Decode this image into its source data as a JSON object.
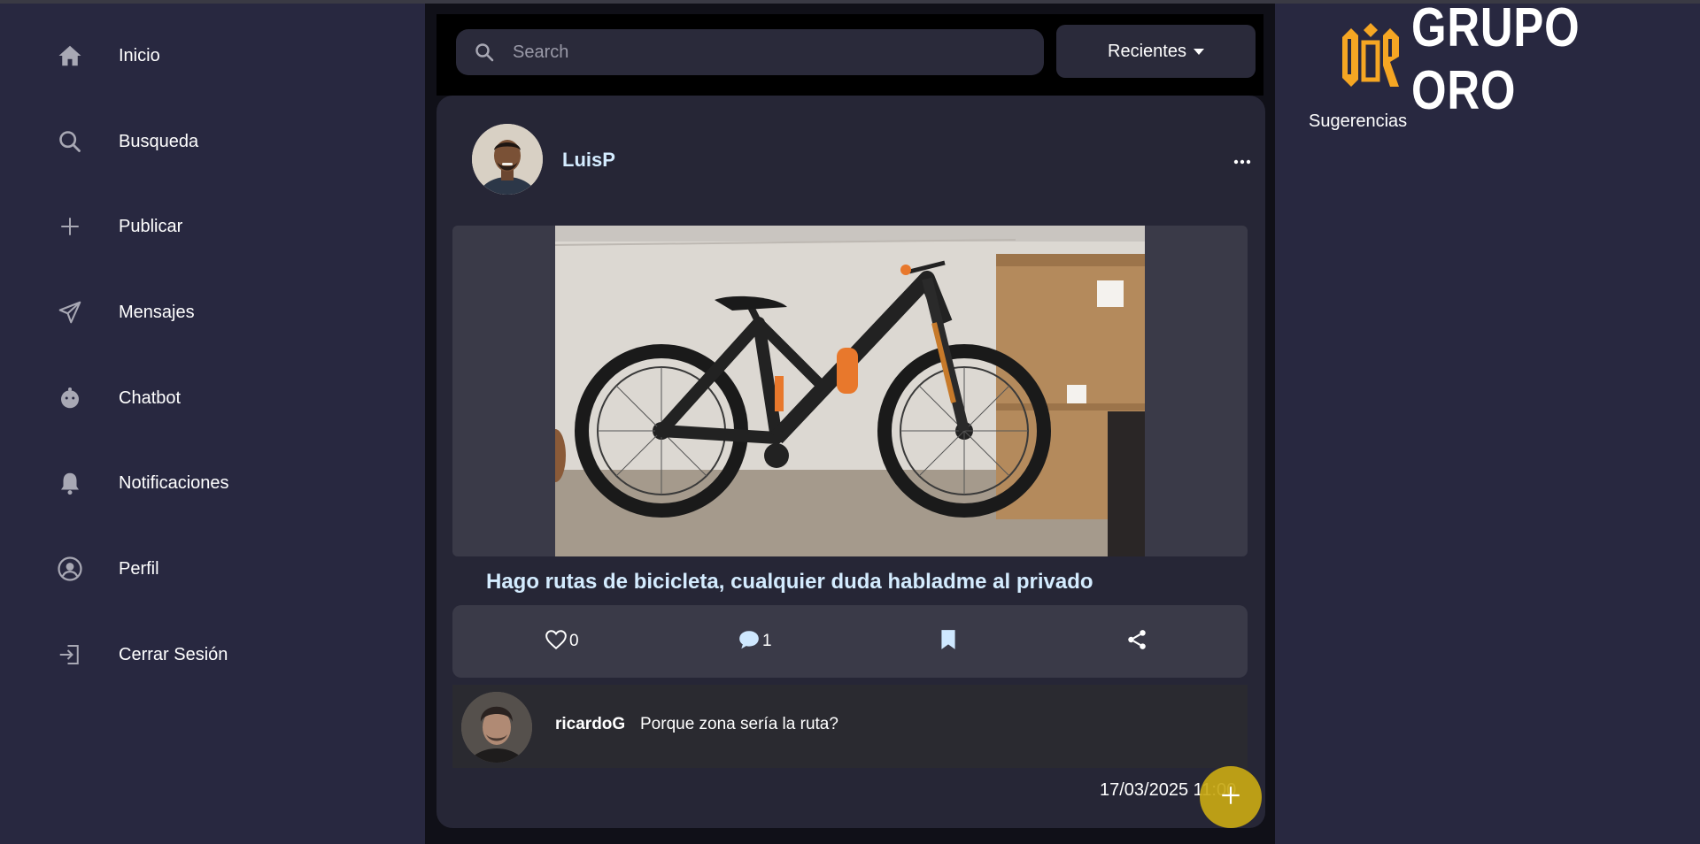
{
  "sidebar": {
    "items": [
      {
        "label": "Inicio",
        "icon": "home-icon"
      },
      {
        "label": "Busqueda",
        "icon": "search-icon"
      },
      {
        "label": "Publicar",
        "icon": "plus-icon"
      },
      {
        "label": "Mensajes",
        "icon": "send-icon"
      },
      {
        "label": "Chatbot",
        "icon": "bot-icon"
      },
      {
        "label": "Notificaciones",
        "icon": "bell-icon"
      },
      {
        "label": "Perfil",
        "icon": "user-circle-icon"
      },
      {
        "label": "Cerrar Sesión",
        "icon": "logout-icon"
      }
    ]
  },
  "search": {
    "placeholder": "Search",
    "value": ""
  },
  "sort": {
    "selected": "Recientes"
  },
  "post": {
    "author": "LuisP",
    "caption": "Hago rutas de bicicleta, cualquier duda habladme al privado",
    "likes": "0",
    "comments_count": "1",
    "timestamp": "17/03/2025 11:00",
    "comments": [
      {
        "user": "ricardoG",
        "text": "Porque zona sería la ruta?"
      }
    ]
  },
  "brand": {
    "name": "GRUPO ORO",
    "accent": "#f5a623"
  },
  "right": {
    "suggestions_title": "Sugerencias"
  },
  "colors": {
    "background": "#282840",
    "card": "#262636",
    "accent_fab": "#c8a814"
  }
}
